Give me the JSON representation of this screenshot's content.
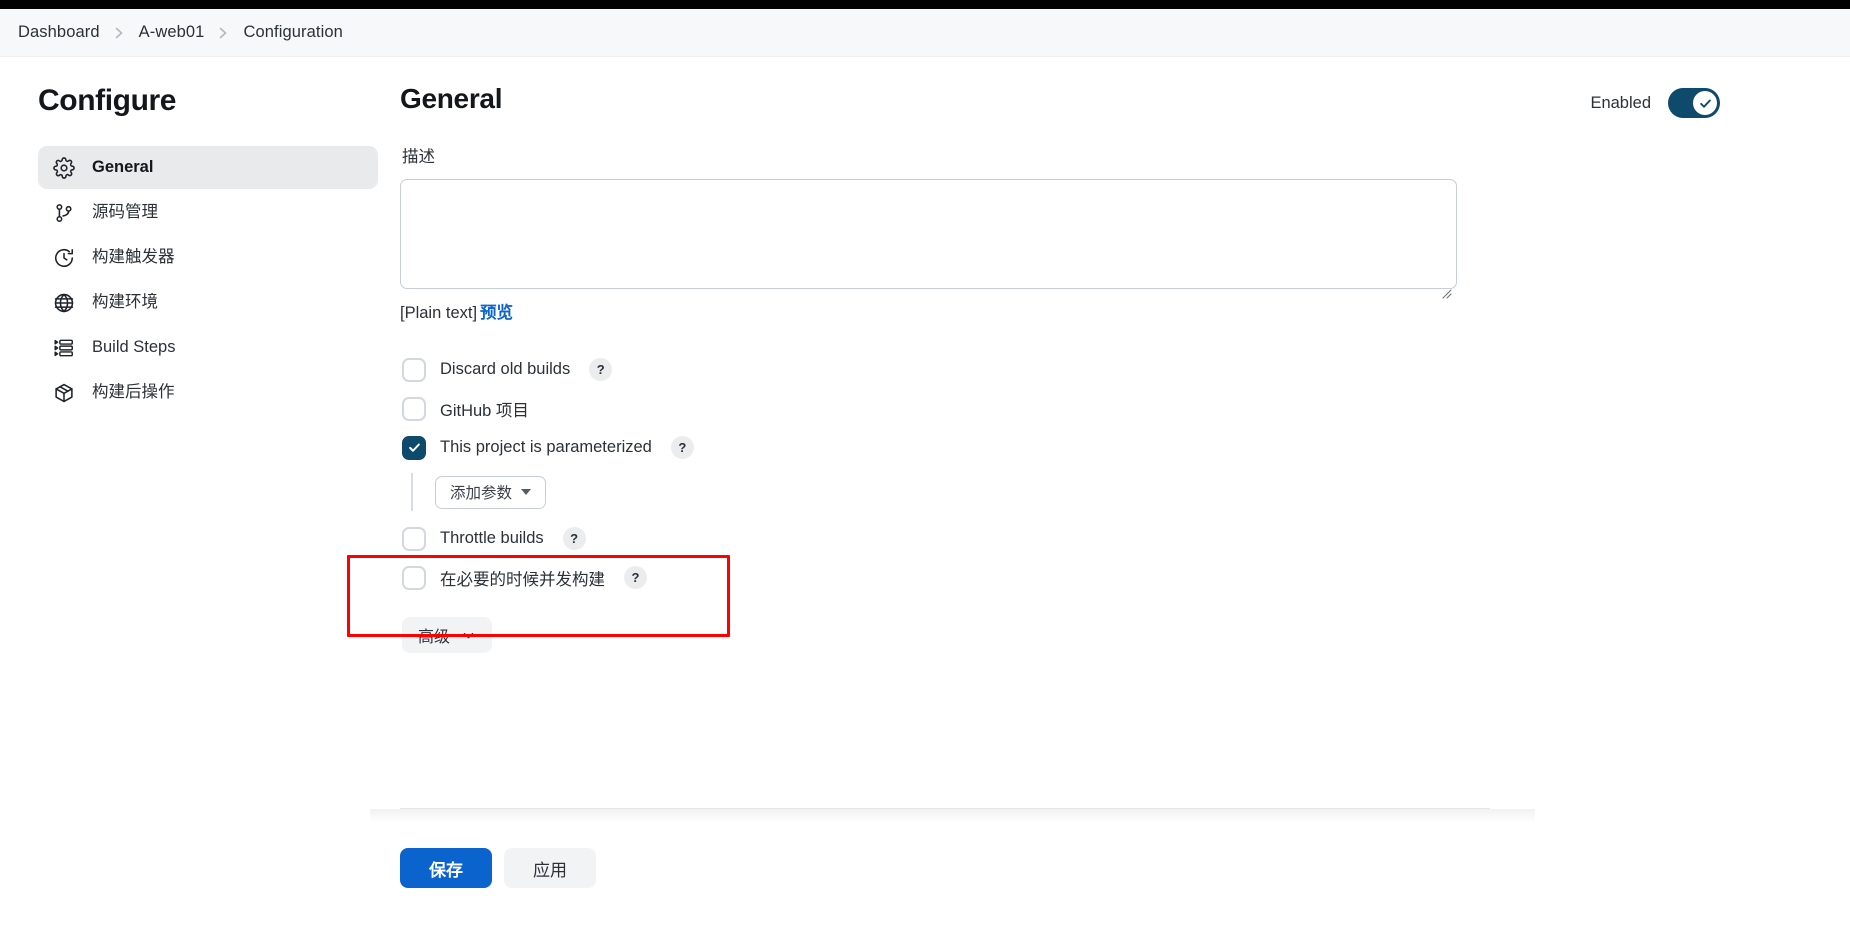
{
  "breadcrumb": {
    "items": [
      {
        "label": "Dashboard",
        "icon": ""
      },
      {
        "label": "A-web01",
        "icon": ""
      },
      {
        "label": "Configuration",
        "icon": ""
      }
    ],
    "separator_icon": "chevron-right-icon"
  },
  "sidebar": {
    "title": "Configure",
    "items": [
      {
        "label": "General",
        "icon": "gear-icon",
        "active": true
      },
      {
        "label": "源码管理",
        "icon": "git-branch-icon",
        "active": false
      },
      {
        "label": "构建触发器",
        "icon": "clock-icon",
        "active": false
      },
      {
        "label": "构建环境",
        "icon": "globe-icon",
        "active": false
      },
      {
        "label": "Build Steps",
        "icon": "list-steps-icon",
        "active": false
      },
      {
        "label": "构建后操作",
        "icon": "package-box-icon",
        "active": false
      }
    ]
  },
  "main": {
    "title": "General",
    "enabled": {
      "label": "Enabled",
      "state": "on",
      "icon": "check-icon",
      "track_color": "#0d4a6b",
      "knob_color": "#ffffff"
    },
    "description": {
      "label": "描述",
      "value": "",
      "placeholder": "",
      "markup_note": "[Plain text]",
      "preview_link": "预览",
      "preview_link_color": "#0b63ce",
      "resize_handle_icon": "resize-grip-icon"
    },
    "checkboxes": [
      {
        "label": "Discard old builds",
        "checked": false,
        "help": "?",
        "has_help": true
      },
      {
        "label": "GitHub 项目",
        "checked": false,
        "help": "?",
        "has_help": false
      },
      {
        "label": "This project is parameterized",
        "checked": true,
        "help": "?",
        "has_help": true,
        "highlighted": true
      },
      {
        "label": "Throttle builds",
        "checked": false,
        "help": "?",
        "has_help": true
      },
      {
        "label": "在必要的时候并发构建",
        "checked": false,
        "help": "?",
        "has_help": true
      }
    ],
    "add_parameter": {
      "label": "添加参数",
      "icon": "caret-down-icon"
    },
    "advanced": {
      "label": "高级",
      "icon": "chevron-down-icon"
    },
    "highlight": {
      "color": "#ff0000",
      "target": "This project is parameterized"
    }
  },
  "footer": {
    "save_label": "保存",
    "apply_label": "应用",
    "save_color": "#0b63ce",
    "apply_color": "#f2f3f5"
  }
}
